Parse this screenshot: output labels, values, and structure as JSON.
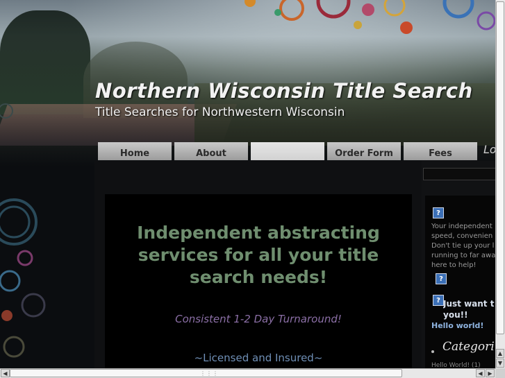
{
  "site": {
    "title": "Northern Wisconsin Title Search",
    "tagline": "Title Searches for Northwestern Wisconsin"
  },
  "nav": {
    "tabs": [
      {
        "label": "Home",
        "active": false
      },
      {
        "label": "About",
        "active": false
      },
      {
        "label": "",
        "active": true
      },
      {
        "label": "Order Form",
        "active": false
      },
      {
        "label": "Fees",
        "active": false
      }
    ],
    "extra": "Lo"
  },
  "main": {
    "headline": "Independent abstracting services for all your title search needs!",
    "turnaround": "Consistent 1-2 Day Turnaround!",
    "licensed": "~Licensed and Insured~"
  },
  "sidebar": {
    "intro_text": "Your independent\nspeed, convenien\nDon't tie up your l\nrunning to far awa\nhere to help!",
    "just_want": "Just want t\nyou!!",
    "hello_link": "Hello world!",
    "categories_heading": "Categori",
    "hello_count": "Hello World! (1)"
  },
  "icons": {
    "help": "?",
    "scroll_up": "▲",
    "scroll_down": "▼",
    "scroll_left": "◀",
    "scroll_right": "▶"
  },
  "colors": {
    "headline": "#6f8e6f",
    "turnaround": "#8b6fa6",
    "licensed": "#6f8fb6",
    "link": "#8fb4e0"
  }
}
